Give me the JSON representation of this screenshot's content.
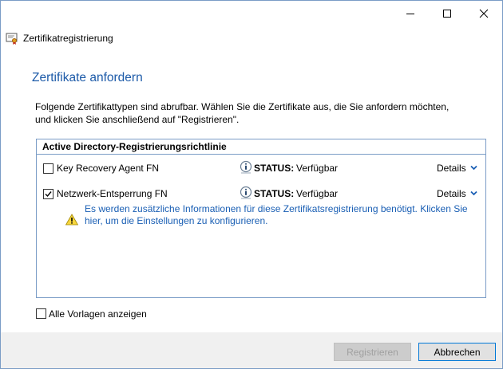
{
  "window": {
    "title": "Zertifikatregistrierung",
    "controls": {
      "minimize": "minimize",
      "maximize": "maximize",
      "close": "close"
    }
  },
  "page": {
    "heading": "Zertifikate anfordern",
    "description": "Folgende Zertifikattypen sind abrufbar. Wählen Sie die Zertifikate aus, die Sie anfordern möchten, und klicken Sie anschließend auf \"Registrieren\"."
  },
  "policy": {
    "title": "Active Directory-Registrierungsrichtlinie",
    "items": [
      {
        "name": "Key Recovery Agent FN",
        "checked": false,
        "status_label": "STATUS:",
        "status_value": "Verfügbar",
        "details": "Details"
      },
      {
        "name": "Netzwerk-Entsperrung FN",
        "checked": true,
        "status_label": "STATUS:",
        "status_value": "Verfügbar",
        "details": "Details"
      }
    ],
    "warning": "Es werden zusätzliche Informationen für diese Zertifikatsregistrierung benötigt. Klicken Sie hier, um die Einstellungen zu konfigurieren."
  },
  "show_all": {
    "label": "Alle Vorlagen anzeigen",
    "checked": false
  },
  "buttons": {
    "register": "Registrieren",
    "cancel": "Abbrechen"
  },
  "colors": {
    "heading": "#1c5aa8",
    "link": "#1a5fb4",
    "border": "#7a9cc6",
    "accent": "#0078d7"
  }
}
